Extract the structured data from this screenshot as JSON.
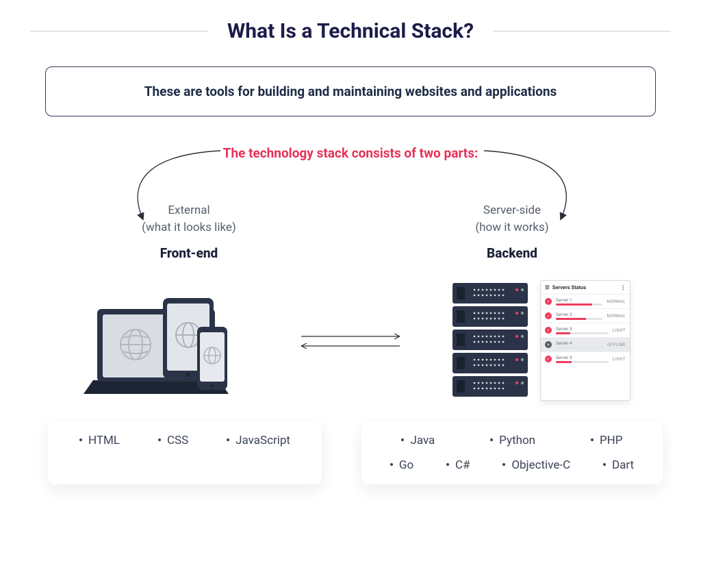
{
  "title": "What Is a Technical Stack?",
  "definition": "These are tools for building and maintaining websites and applications",
  "subhead": "The technology stack consists of two parts:",
  "columns": {
    "frontend": {
      "lede_l1": "External",
      "lede_l2": "(what it looks like)",
      "title": "Front-end",
      "tech": [
        "HTML",
        "CSS",
        "JavaScript"
      ]
    },
    "backend": {
      "lede_l1": "Server-side",
      "lede_l2": "(how it works)",
      "title": "Backend",
      "tech_row1": [
        "Java",
        "Python",
        "PHP"
      ],
      "tech_row2": [
        "Go",
        "C#",
        "Objective-C",
        "Dart"
      ]
    }
  },
  "server_status": {
    "title": "Servers Status",
    "rows": [
      {
        "name": "Server 1",
        "state": "NORMAL",
        "fill": 78,
        "on": true
      },
      {
        "name": "Server 2",
        "state": "NORMAL",
        "fill": 64,
        "on": true
      },
      {
        "name": "Server 3",
        "state": "LIGHT",
        "fill": 28,
        "on": true
      },
      {
        "name": "Server 4",
        "state": "OFFLINE",
        "fill": 0,
        "on": false
      },
      {
        "name": "Server 3",
        "state": "LIGHT",
        "fill": 30,
        "on": true
      }
    ]
  },
  "colors": {
    "title": "#1c1b4a",
    "accent": "#e6325a",
    "text": "#3a4356",
    "line": "#d0d0d8"
  }
}
